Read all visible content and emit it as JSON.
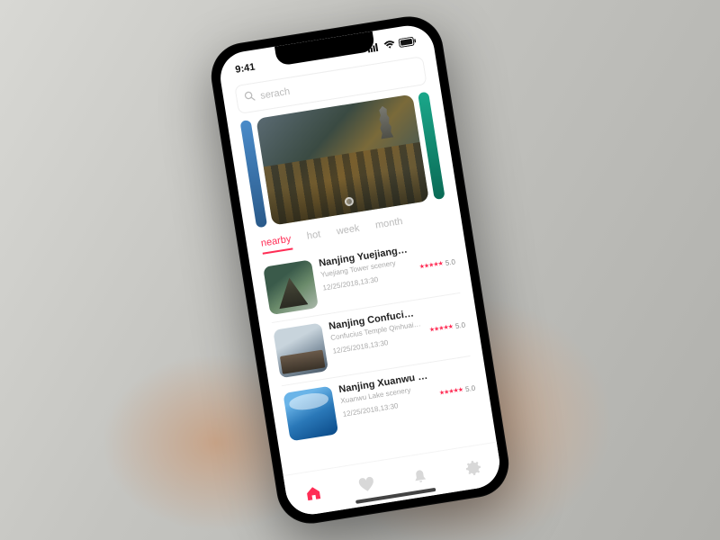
{
  "status": {
    "time": "9:41"
  },
  "search": {
    "placeholder": "serach"
  },
  "tabs": [
    {
      "label": "nearby",
      "active": true
    },
    {
      "label": "hot",
      "active": false
    },
    {
      "label": "week",
      "active": false
    },
    {
      "label": "month",
      "active": false
    }
  ],
  "items": [
    {
      "title": "Nanjing Yuejiang Tower",
      "subtitle": "Yuejiang Tower scenery",
      "date": "12/25/2018,13:30",
      "rating": "5.0"
    },
    {
      "title": "Nanjing Confucius Temple",
      "subtitle": "Confucius Temple Qinhuai scenery",
      "date": "12/25/2018,13:30",
      "rating": "5.0"
    },
    {
      "title": "Nanjing Xuanwu Lake",
      "subtitle": "Xuanwu Lake scenery",
      "date": "12/25/2018,13:30",
      "rating": "5.0"
    }
  ],
  "nav": {
    "activeIndex": 0
  }
}
